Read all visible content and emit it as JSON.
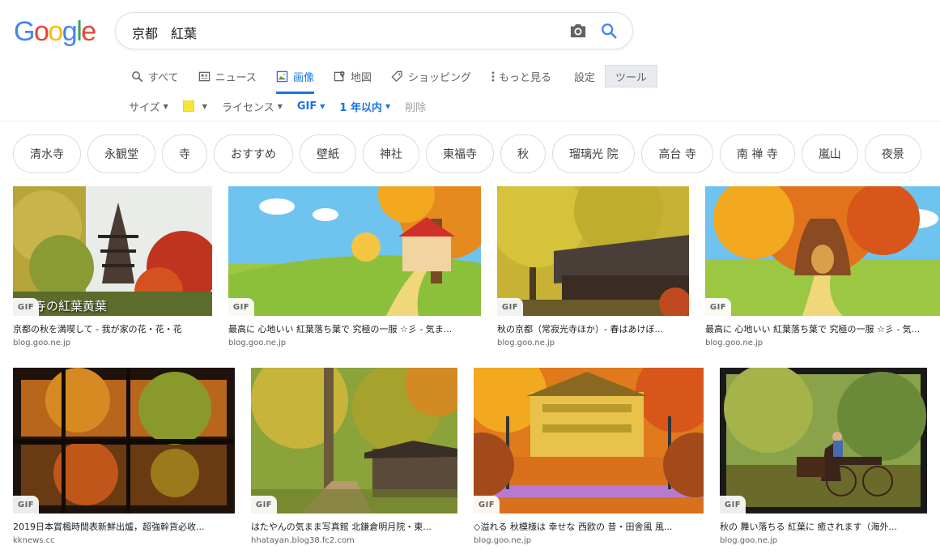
{
  "logo": {
    "letters": [
      "G",
      "o",
      "o",
      "g",
      "l",
      "e"
    ],
    "colors": [
      "#4285f4",
      "#ea4335",
      "#fbbc05",
      "#4285f4",
      "#34a853",
      "#ea4335"
    ]
  },
  "search": {
    "query": "京都　紅葉"
  },
  "tabs": [
    {
      "label": "すべて",
      "icon": "search-icon"
    },
    {
      "label": "ニュース",
      "icon": "news-icon"
    },
    {
      "label": "画像",
      "icon": "image-icon",
      "active": true
    },
    {
      "label": "地図",
      "icon": "map-icon"
    },
    {
      "label": "ショッピング",
      "icon": "tag-icon"
    },
    {
      "label": "もっと見る",
      "icon": "more-vert-icon"
    }
  ],
  "settings_label": "設定",
  "tools_label": "ツール",
  "filters": {
    "size": "サイズ",
    "color": "#f5e73a",
    "license": "ライセンス",
    "type": "GIF",
    "time": "1 年以内",
    "clear": "削除"
  },
  "chips": [
    "清水寺",
    "永観堂",
    "寺",
    "おすすめ",
    "壁紙",
    "神社",
    "東福寺",
    "秋",
    "瑠璃光 院",
    "高台 寺",
    "南 禅 寺",
    "嵐山",
    "夜景"
  ],
  "badge": "GIF",
  "results": [
    {
      "title": "京都の秋を満喫して - 我が家の花・花・花",
      "source": "blog.goo.ne.jp",
      "overlay": "寺の紅葉黄葉"
    },
    {
      "title": "最高に 心地いい 紅葉落ち葉で 究極の一服 ☆彡 - 気ま...",
      "source": "blog.goo.ne.jp"
    },
    {
      "title": "秋の京都（常寂光寺ほか）- 春はあけぼ...",
      "source": "blog.goo.ne.jp"
    },
    {
      "title": "最高に 心地いい 紅葉落ち葉で 究極の一服 ☆彡 - 気...",
      "source": "blog.goo.ne.jp"
    },
    {
      "title": "2019日本賞楓時間表新鮮出爐，超強幹貨必收...",
      "source": "kknews.cc"
    },
    {
      "title": "はたやんの気まま写真館 北鎌倉明月院・東...",
      "source": "hhatayan.blog38.fc2.com"
    },
    {
      "title": "◇溢れる 秋模様は 幸せな 西欧の 昔・田舎風 風...",
      "source": "blog.goo.ne.jp"
    },
    {
      "title": "秋の 舞い落ちる 紅葉に 癒されます（海外...",
      "source": "blog.goo.ne.jp"
    }
  ]
}
